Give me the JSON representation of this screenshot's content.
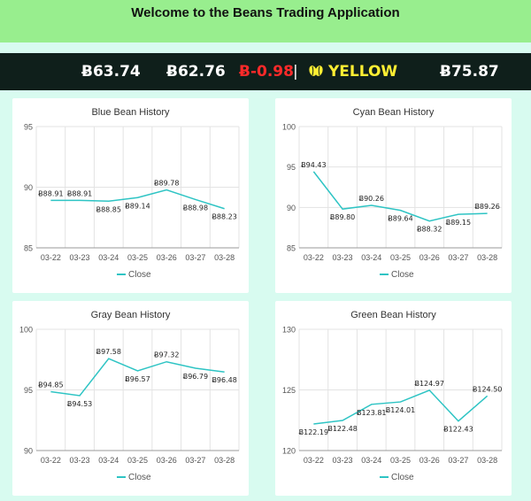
{
  "header": {
    "title": "Welcome to the Beans Trading Application"
  },
  "ticker": {
    "items": [
      {
        "text": "Ƀ63.74",
        "type": "price"
      },
      {
        "text": "Ƀ62.76",
        "type": "price"
      },
      {
        "text": "Ƀ-0.98",
        "type": "negative"
      },
      {
        "text": "|",
        "type": "separator"
      },
      {
        "text": "YELLOW",
        "type": "bean-name"
      },
      {
        "text": "Ƀ75.87",
        "type": "price"
      }
    ],
    "icon": "bean-icon",
    "colors": {
      "background": "#0f1f1b",
      "negative": "#ff2a2a",
      "bean_name": "#ffee33"
    }
  },
  "colors": {
    "header_bg": "#98ee8e",
    "page_bg": "#d8fbf0",
    "line": "#2ec4c4"
  },
  "chart_data": [
    {
      "type": "line",
      "title": "Blue Bean History",
      "categories": [
        "03-22",
        "03-23",
        "03-24",
        "03-25",
        "03-26",
        "03-27",
        "03-28"
      ],
      "series": [
        {
          "name": "Close",
          "values": [
            88.91,
            88.91,
            88.85,
            89.14,
            89.78,
            88.98,
            88.23
          ]
        }
      ],
      "labels": [
        "Ƀ88.91",
        "Ƀ88.91",
        "Ƀ88.85",
        "Ƀ89.14",
        "Ƀ89.78",
        "Ƀ88.98",
        "Ƀ88.23"
      ],
      "yticks": [
        85,
        90,
        95
      ],
      "ylim": [
        85,
        95
      ],
      "legend": "bottom"
    },
    {
      "type": "line",
      "title": "Cyan Bean History",
      "categories": [
        "03-22",
        "03-23",
        "03-24",
        "03-25",
        "03-26",
        "03-27",
        "03-28"
      ],
      "series": [
        {
          "name": "Close",
          "values": [
            94.43,
            89.8,
            90.26,
            89.64,
            88.32,
            89.15,
            89.26
          ]
        }
      ],
      "labels": [
        "Ƀ94.43",
        "Ƀ89.80",
        "Ƀ90.26",
        "Ƀ89.64",
        "Ƀ88.32",
        "Ƀ89.15",
        "Ƀ89.26"
      ],
      "yticks": [
        85,
        90,
        95,
        100
      ],
      "ylim": [
        85,
        100
      ],
      "legend": "bottom"
    },
    {
      "type": "line",
      "title": "Gray Bean History",
      "categories": [
        "03-22",
        "03-23",
        "03-24",
        "03-25",
        "03-26",
        "03-27",
        "03-28"
      ],
      "series": [
        {
          "name": "Close",
          "values": [
            94.85,
            94.53,
            97.58,
            96.57,
            97.32,
            96.79,
            96.48
          ]
        }
      ],
      "labels": [
        "Ƀ94.85",
        "Ƀ94.53",
        "Ƀ97.58",
        "Ƀ96.57",
        "Ƀ97.32",
        "Ƀ96.79",
        "Ƀ96.48"
      ],
      "yticks": [
        90,
        95,
        100
      ],
      "ylim": [
        90,
        100
      ],
      "legend": "bottom"
    },
    {
      "type": "line",
      "title": "Green Bean History",
      "categories": [
        "03-22",
        "03-23",
        "03-24",
        "03-25",
        "03-26",
        "03-27",
        "03-28"
      ],
      "series": [
        {
          "name": "Close",
          "values": [
            122.19,
            122.48,
            123.81,
            124.01,
            124.97,
            122.43,
            124.5
          ]
        }
      ],
      "labels": [
        "Ƀ122.19",
        "Ƀ122.48",
        "Ƀ123.81",
        "Ƀ124.01",
        "Ƀ124.97",
        "Ƀ122.43",
        "Ƀ124.50"
      ],
      "yticks": [
        120,
        125,
        130
      ],
      "ylim": [
        120,
        130
      ],
      "legend": "bottom"
    }
  ]
}
